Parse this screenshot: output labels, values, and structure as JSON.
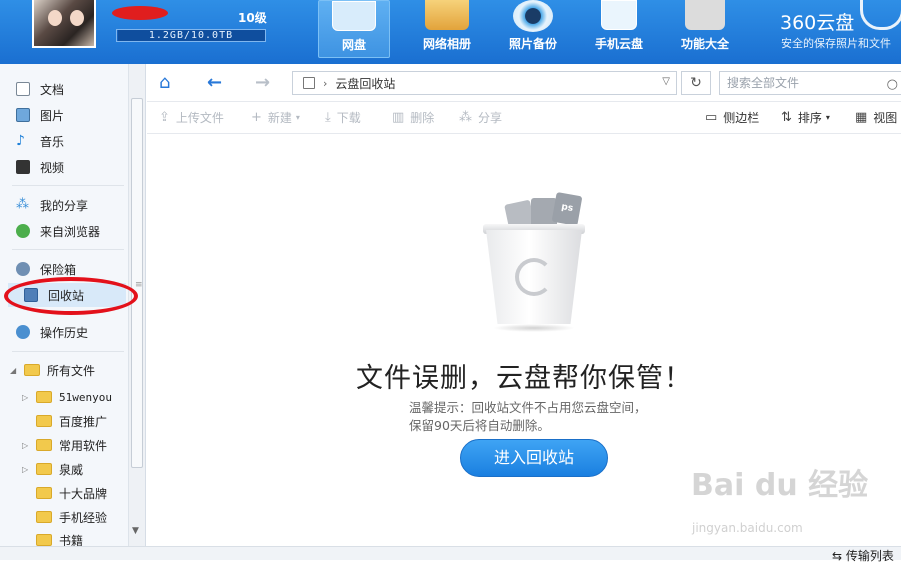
{
  "header": {
    "level": "10级",
    "storage": "1.2GB/10.0TB",
    "storage_fraction": 0.00012,
    "tabs": [
      {
        "label": "网盘",
        "icon": "cloud-icon",
        "active": true
      },
      {
        "label": "网络相册",
        "icon": "album-icon"
      },
      {
        "label": "照片备份",
        "icon": "camera-icon"
      },
      {
        "label": "手机云盘",
        "icon": "phone-cloud-icon"
      },
      {
        "label": "功能大全",
        "icon": "tools-icon"
      }
    ],
    "brand": "360云盘",
    "slogan": "安全的保存照片和文件"
  },
  "sidebar": {
    "items": [
      {
        "label": "文档",
        "icon": "document-icon"
      },
      {
        "label": "图片",
        "icon": "image-icon"
      },
      {
        "label": "音乐",
        "icon": "music-icon"
      },
      {
        "label": "视频",
        "icon": "video-icon"
      },
      {
        "label": "我的分享",
        "icon": "share-icon"
      },
      {
        "label": "来自浏览器",
        "icon": "browser-icon"
      },
      {
        "label": "保险箱",
        "icon": "safe-icon"
      },
      {
        "label": "回收站",
        "icon": "recycle-bin-icon",
        "active": true
      },
      {
        "label": "操作历史",
        "icon": "history-icon"
      }
    ],
    "tree_root": "所有文件",
    "folders": [
      {
        "label": "51wenyou",
        "expandable": true
      },
      {
        "label": "百度推广",
        "expandable": false
      },
      {
        "label": "常用软件",
        "expandable": true
      },
      {
        "label": "泉威",
        "expandable": true
      },
      {
        "label": "十大品牌",
        "expandable": false
      },
      {
        "label": "手机经验",
        "expandable": false
      },
      {
        "label": "书籍",
        "expandable": false
      }
    ]
  },
  "address": {
    "path": "云盘回收站",
    "search_placeholder": "搜索全部文件"
  },
  "toolbar": {
    "upload": "上传文件",
    "new": "新建",
    "download": "下载",
    "delete": "删除",
    "share": "分享",
    "sidebar": "侧边栏",
    "sort": "排序",
    "view": "视图"
  },
  "main": {
    "doc_badges": [
      "ps"
    ],
    "title": "文件误删，云盘帮你保管！",
    "hint_line1": "温馨提示：回收站文件不占用您云盘空间，",
    "hint_line2": "保留90天后将自动删除。",
    "enter_button": "进入回收站"
  },
  "statusbar": {
    "transfer_list": "传输列表"
  },
  "watermark": {
    "text": "Bai du 经验",
    "sub": "jingyan.baidu.com"
  },
  "colors": {
    "header_blue": "#1a6fd1",
    "accent_blue": "#2878d8",
    "highlight_red": "#e3111b"
  }
}
